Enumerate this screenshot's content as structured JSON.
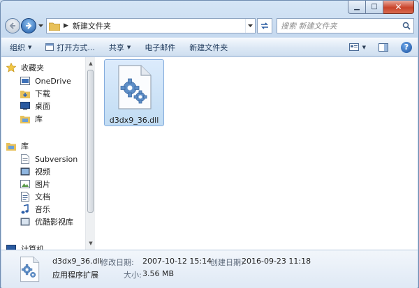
{
  "address": {
    "folder": "新建文件夹"
  },
  "search": {
    "placeholder": "搜索 新建文件夹"
  },
  "toolbar": {
    "organize": "组织",
    "open_with": "打开方式...",
    "share": "共享",
    "email": "电子邮件",
    "new_folder": "新建文件夹"
  },
  "nav": {
    "favorites": "收藏夹",
    "favorites_items": [
      "OneDrive",
      "下载",
      "桌面",
      "库"
    ],
    "libraries": "库",
    "library_items": [
      "Subversion",
      "视频",
      "图片",
      "文档",
      "音乐",
      "优酷影视库"
    ],
    "computer": "计算机"
  },
  "file": {
    "name": "d3dx9_36.dll"
  },
  "details": {
    "name": "d3dx9_36.dll",
    "type": "应用程序扩展",
    "modified_label": "修改日期:",
    "modified_value": "2007-10-12 15:14",
    "created_label": "创建日期:",
    "created_value": "2016-09-23 11:18",
    "size_label": "大小:",
    "size_value": "3.56 MB"
  },
  "colors": {
    "accent": "#1f5aa6",
    "selection": "#cce4f7",
    "folder": "#e8c15a"
  },
  "icons": [
    "minimize-icon",
    "maximize-icon",
    "close-icon",
    "back-arrow-icon",
    "forward-arrow-icon",
    "folder-icon",
    "refresh-icon",
    "search-icon",
    "gear-file-icon",
    "star-icon",
    "help-icon"
  ]
}
